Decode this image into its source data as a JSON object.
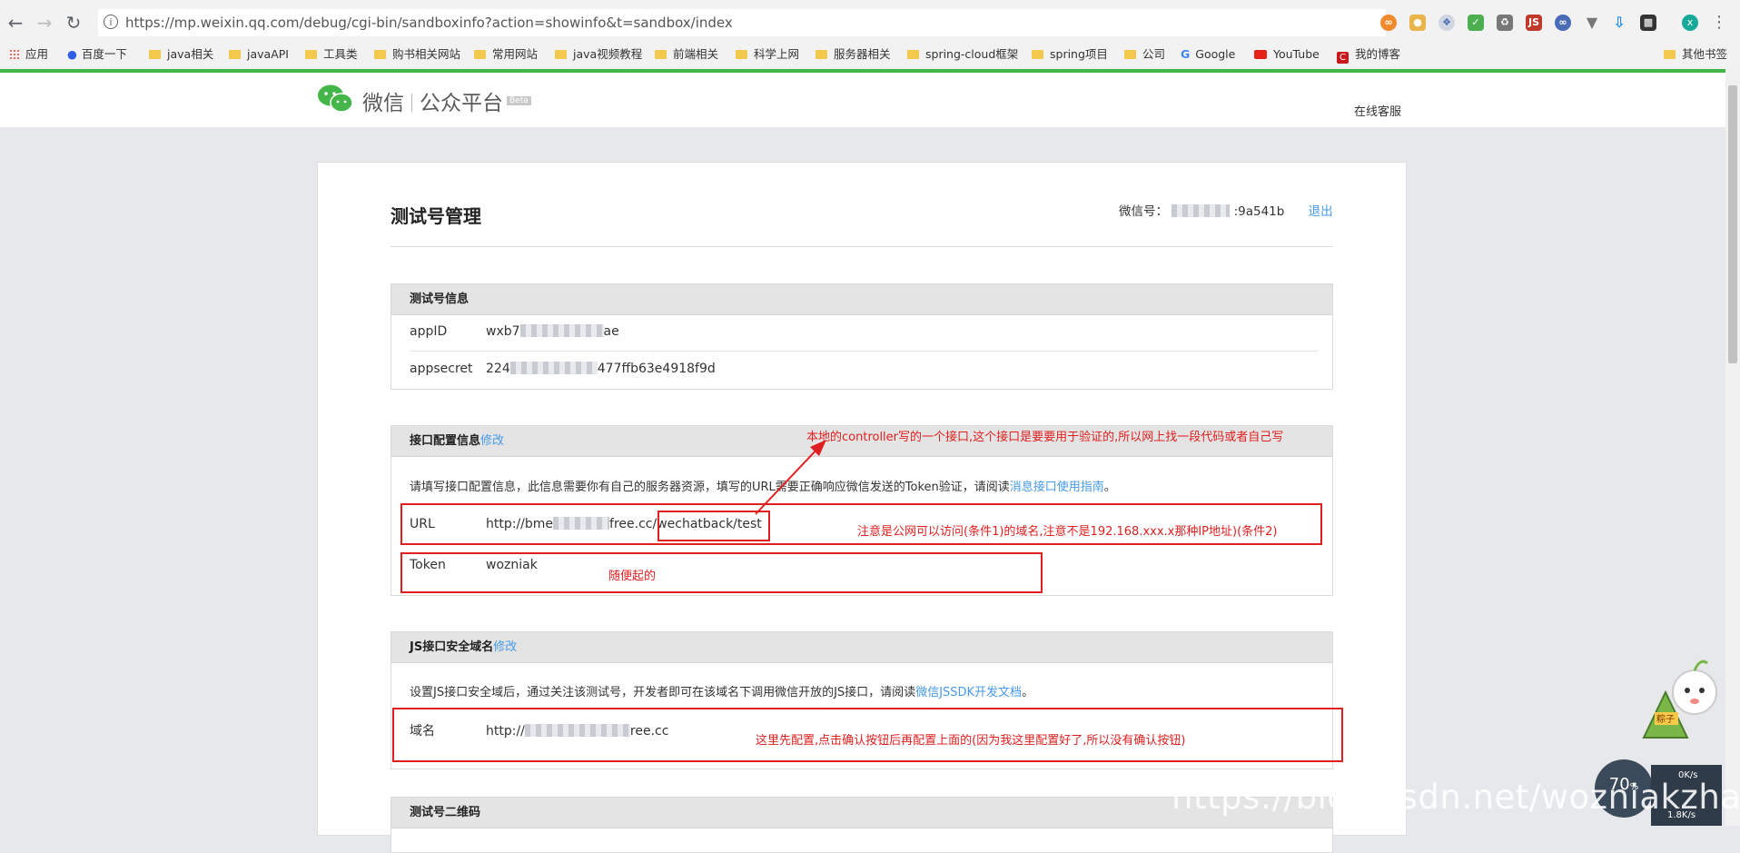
{
  "browser": {
    "url": "https://mp.weixin.qq.com/debug/cgi-bin/sandboxinfo?action=showinfo&t=sandbox/index",
    "profile_initial": "x",
    "bookmarks": [
      "应用",
      "百度一下",
      "java相关",
      "javaAPI",
      "工具类",
      "购书相关网站",
      "常用网站",
      "java视频教程",
      "前端相关",
      "科学上网",
      "服务器相关",
      "spring-cloud框架",
      "spring项目",
      "公司",
      "Google",
      "YouTube",
      "我的博客"
    ],
    "other_bookmarks": "其他书签"
  },
  "header": {
    "logo_name": "微信",
    "logo_sub": "公众平台",
    "beta": "Beta",
    "support": "在线客服"
  },
  "page": {
    "title": "测试号管理",
    "account_label": "微信号：",
    "account_suffix": ":9a541b",
    "logout": "退出"
  },
  "test_info": {
    "title": "测试号信息",
    "appid_key": "appID",
    "appid_prefix": "wxb7",
    "appid_suffix": "ae",
    "secret_key": "appsecret",
    "secret_prefix": "224",
    "secret_suffix": "477ffb63e4918f9d"
  },
  "interface_config": {
    "title": "接口配置信息",
    "edit": "修改",
    "desc": "请填写接口配置信息，此信息需要你有自己的服务器资源，填写的URL需要正确响应微信发送的Token验证，请阅读",
    "desc_link": "消息接口使用指南",
    "desc_end": "。",
    "url_key": "URL",
    "url_prefix": "http://bme",
    "url_mid": "free.cc",
    "url_path": "/wechatback/test",
    "token_key": "Token",
    "token_value": "wozniak"
  },
  "js_domain": {
    "title": "JS接口安全域名",
    "edit": "修改",
    "desc": "设置JS接口安全域后，通过关注该测试号，开发者即可在该域名下调用微信开放的JS接口，请阅读",
    "desc_link": "微信JSSDK开发文档",
    "desc_end": "。",
    "domain_key": "域名",
    "domain_prefix": "http://",
    "domain_suffix": "ree.cc"
  },
  "qrcode": {
    "title": "测试号二维码"
  },
  "annotations": {
    "top": "本地的controller写的一个接口,这个接口是要要用于验证的,所以网上找一段代码或者自己写",
    "url": "注意是公网可以访问(条件1)的域名,注意不是192.168.xxx.x那种IP地址)(条件2)",
    "token": "随便起的",
    "domain": "这里先配置,点击确认按钮后再配置上面的(因为我这里配置好了,所以没有确认按钮)"
  },
  "overlay": {
    "watermark": "https://blog.csdn.net/wozniakzhang",
    "speed_value": "70",
    "speed_unit": "%",
    "upload": "0K/s",
    "download": "1.8K/s",
    "mascot_label": "粽子"
  },
  "colors": {
    "accent_green": "#44b549",
    "link_blue": "#459ae9",
    "annotation_red": "#e02020"
  }
}
